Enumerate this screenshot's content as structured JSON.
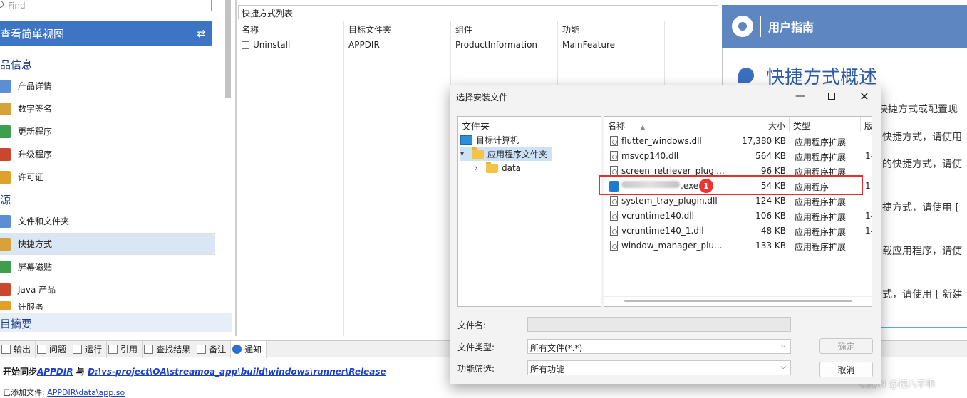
{
  "left": {
    "find_placeholder": "Find",
    "simple_view": "查看简单视图",
    "section_product": "品信息",
    "product_items": [
      "产品详情",
      "数字签名",
      "更新程序",
      "升级程序",
      "许可证"
    ],
    "section_resources": "源",
    "resource_items": [
      "文件和文件夹",
      "快捷方式",
      "屏幕磁贴",
      "Java 产品",
      "计服务"
    ],
    "selected_item": "快捷方式",
    "summary": "目摘要"
  },
  "shortcuts": {
    "header": "快捷方式列表",
    "columns": [
      "名称",
      "目标文件夹",
      "组件",
      "功能"
    ],
    "rows": [
      {
        "name": "Uninstall",
        "target": "APPDIR",
        "component": "ProductInformation",
        "feature": "MainFeature"
      }
    ]
  },
  "guide": {
    "header": "用户指南",
    "title": "快捷方式概述",
    "lines": [
      "快捷方式或配置现",
      "快捷方式，请使用",
      "的快捷方式，请使",
      "捷方式，请使用 [",
      "载应用程序，请使",
      "式，请使用 [ 新建"
    ]
  },
  "bottom": {
    "tabs": [
      "输出",
      "问题",
      "运行",
      "引用",
      "查找结果",
      "备注",
      "通知"
    ],
    "active_tab": "通知",
    "sync_prefix": "开始同步",
    "sync_src": "APPDIR",
    "sync_mid": "与",
    "sync_dst": "D:\\vs-project\\OA\\streamoa_app\\build\\windows\\runner\\Release",
    "added_prefix": "已添加文件:",
    "added_path": "APPDIR\\data\\app.so",
    "watermark": "CSDN @初八不乖"
  },
  "dialog": {
    "title": "选择安装文件",
    "tree_header": "文件夹",
    "tree": [
      {
        "label": "目标计算机",
        "level": 0,
        "expander": ""
      },
      {
        "label": "应用程序文件夹",
        "level": 1,
        "expander": "⌵"
      },
      {
        "label": "data",
        "level": 2,
        "expander": "›"
      }
    ],
    "file_columns": [
      "名称",
      "大小",
      "类型",
      "版"
    ],
    "files": [
      {
        "name": "flutter_windows.dll",
        "size": "17,380 KB",
        "type": "应用程序扩展",
        "ver": ""
      },
      {
        "name": "msvcp140.dll",
        "size": "564 KB",
        "type": "应用程序扩展",
        "ver": "14"
      },
      {
        "name": "screen_retriever_plugi...",
        "size": "96 KB",
        "type": "应用程序扩展",
        "ver": ""
      },
      {
        "name": ".exe",
        "size": "54 KB",
        "type": "应用程序",
        "ver": "1."
      },
      {
        "name": "system_tray_plugin.dll",
        "size": "124 KB",
        "type": "应用程序扩展",
        "ver": ""
      },
      {
        "name": "vcruntime140.dll",
        "size": "106 KB",
        "type": "应用程序扩展",
        "ver": "14"
      },
      {
        "name": "vcruntime140_1.dll",
        "size": "48 KB",
        "type": "应用程序扩展",
        "ver": "14"
      },
      {
        "name": "window_manager_plu...",
        "size": "133 KB",
        "type": "应用程序扩展",
        "ver": ""
      }
    ],
    "badge": "1",
    "filename_label": "文件名:",
    "filename_value": "",
    "filetype_label": "文件类型:",
    "filetype_value": "所有文件(*.*)",
    "feature_label": "功能筛选:",
    "feature_value": "所有功能",
    "ok": "确定",
    "cancel": "取消"
  },
  "colors": {
    "accent": "#3e74c4",
    "guide_header": "#5e87c2",
    "highlight": "#e03030"
  }
}
